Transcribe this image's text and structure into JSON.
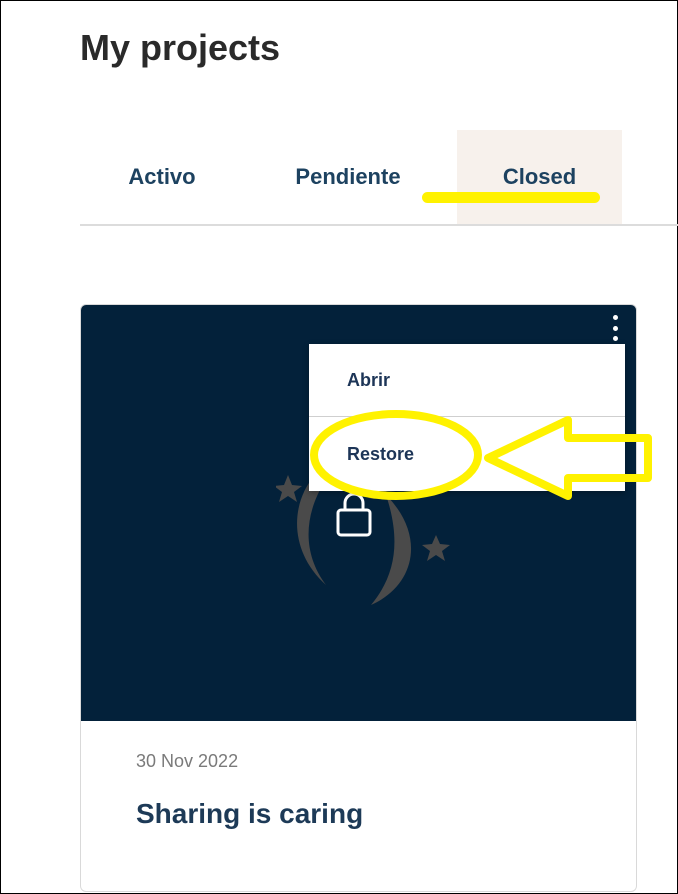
{
  "page": {
    "title": "My projects"
  },
  "tabs": [
    {
      "label": "Activo",
      "active": false
    },
    {
      "label": "Pendiente",
      "active": false
    },
    {
      "label": "Closed",
      "active": true
    }
  ],
  "project_card": {
    "date": "30 Nov 2022",
    "title": "Sharing is caring",
    "image_background": "#03213a",
    "menu": {
      "items": [
        {
          "label": "Abrir"
        },
        {
          "label": "Restore"
        }
      ]
    }
  },
  "icons": {
    "kebab": "kebab-menu-icon",
    "lock": "lock-icon",
    "logo": "moon-stars-logo-icon"
  },
  "colors": {
    "annotation": "#fff200",
    "tab_text": "#1d4260",
    "active_tab_bg": "#f7f1ec",
    "card_image_bg": "#03213a"
  }
}
